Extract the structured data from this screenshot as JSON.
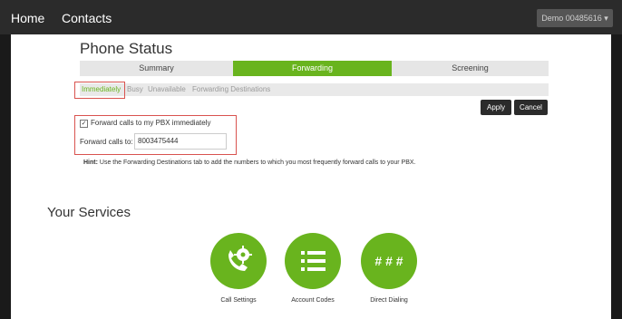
{
  "nav": {
    "home": "Home",
    "contacts": "Contacts",
    "user_menu": "Demo 00485616 ▾"
  },
  "page": {
    "title": "Phone Status"
  },
  "tabs": [
    {
      "label": "Summary",
      "active": false
    },
    {
      "label": "Forwarding",
      "active": true
    },
    {
      "label": "Screening",
      "active": false
    }
  ],
  "subtabs": [
    {
      "label": "Immediately",
      "active": true
    },
    {
      "label": "Busy",
      "active": false
    },
    {
      "label": "Unavailable",
      "active": false
    },
    {
      "label": "Forwarding Destinations",
      "active": false
    }
  ],
  "buttons": {
    "apply": "Apply",
    "cancel": "Cancel"
  },
  "form": {
    "checkbox_label": "Forward calls to my PBX immediately",
    "checkbox_checked": true,
    "forward_label": "Forward calls to:",
    "forward_value": "8003475444"
  },
  "hint": {
    "prefix": "Hint:",
    "text": " Use the Forwarding Destinations tab to add the numbers to which you most frequently forward calls to your PBX."
  },
  "services": {
    "title": "Your Services",
    "items": [
      {
        "label": "Call Settings",
        "icon": "phone-gear-icon",
        "glyph": ""
      },
      {
        "label": "Account Codes",
        "icon": "list-icon",
        "glyph": ""
      },
      {
        "label": "Direct Dialing",
        "icon": "hash-icon",
        "glyph": "# # #"
      }
    ]
  },
  "colors": {
    "accent": "#69b41e",
    "highlight": "#d9534f",
    "topbar": "#2b2b2b"
  }
}
